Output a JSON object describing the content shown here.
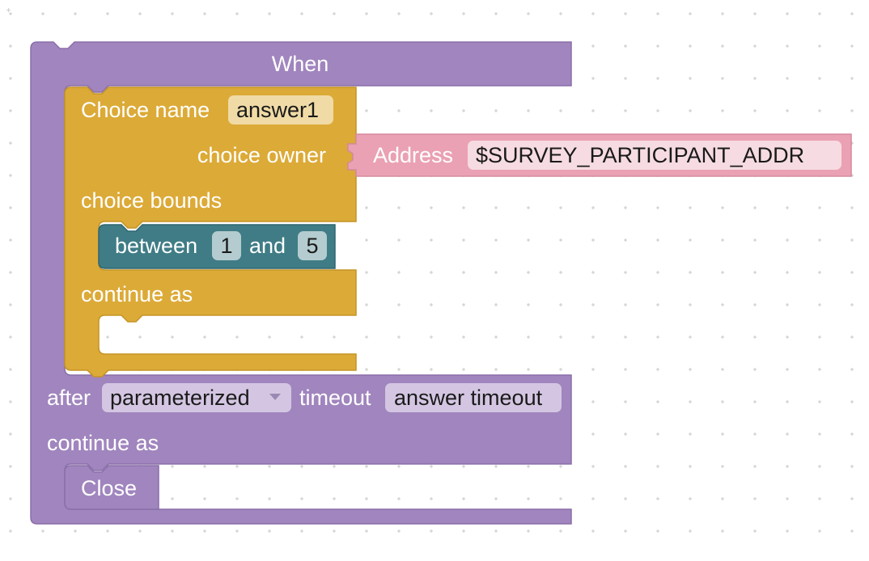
{
  "colors": {
    "when_block": "#a085be",
    "when_block_dark": "#8a6fa8",
    "choice_block": "#dcaa37",
    "choice_block_dark": "#c59325",
    "address_block": "#eaa1b3",
    "address_block_dark": "#d68a9e",
    "between_block": "#3f7c86",
    "between_block_dark": "#2f6670",
    "close_block": "#a085be",
    "field_bg_choice": "#f0dba6",
    "field_bg_address": "#f6dbe2",
    "field_bg_between": "#b4cccf",
    "field_bg_when": "#d4c6e2",
    "grid_dot": "#c8c8c8"
  },
  "when_block": {
    "title": "When",
    "after_label": "after",
    "timeout_type": "parameterized",
    "timeout_label": "timeout",
    "timeout_value": "answer timeout",
    "continue_label": "continue as"
  },
  "choice_block": {
    "name_label": "Choice name",
    "name_value": "answer1",
    "owner_label": "choice owner",
    "bounds_label": "choice bounds",
    "continue_label": "continue as"
  },
  "address_block": {
    "label": "Address",
    "value": "$SURVEY_PARTICIPANT_ADDR"
  },
  "between_block": {
    "label": "between",
    "low": "1",
    "and_label": "and",
    "high": "5"
  },
  "close_block": {
    "label": "Close"
  },
  "icons": {
    "dropdown": "chevron-down-icon"
  }
}
